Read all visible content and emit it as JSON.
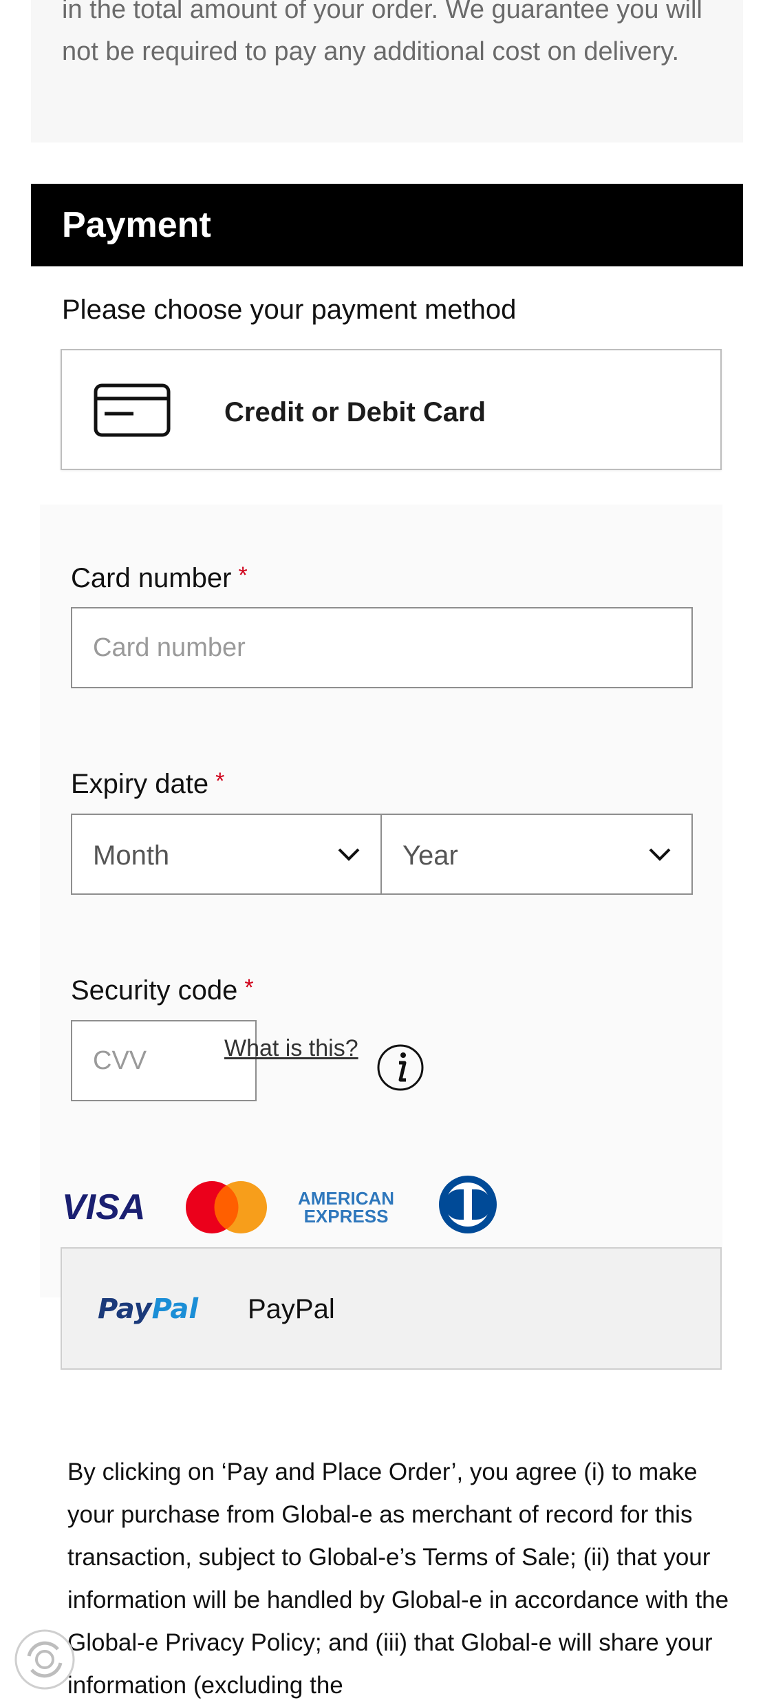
{
  "intro": {
    "text": "in the total amount of your order. We guarantee you will not be required to pay any additional cost on delivery."
  },
  "payment": {
    "title": "Payment",
    "choose_label": "Please choose your payment method",
    "card_option": {
      "label": "Credit or Debit Card",
      "icon": "credit-card-icon"
    },
    "form": {
      "card_number": {
        "label": "Card number",
        "required_mark": "*",
        "placeholder": "Card number",
        "value": ""
      },
      "expiry": {
        "label": "Expiry date",
        "required_mark": "*",
        "month": {
          "selected": "Month"
        },
        "year": {
          "selected": "Year"
        }
      },
      "security": {
        "label": "Security code",
        "required_mark": "*",
        "placeholder": "CVV",
        "value": "",
        "help_link": "What is this?",
        "info_icon": "info-icon"
      }
    },
    "card_brands": {
      "visa": "VISA",
      "mastercard": "mastercard-logo",
      "amex_line1": "AMERICAN",
      "amex_line2": "EXPRESS",
      "diners": "diners-club-logo"
    },
    "paypal_option": {
      "logo_part1": "Pay",
      "logo_part2": "Pal",
      "label": "PayPal"
    }
  },
  "terms": {
    "text": "By clicking on ‘Pay and Place Order’, you agree (i) to make your purchase from Global-e as merchant of record for this transaction, subject to Global-e’s Terms of Sale; (ii) that your information will be handled by Global-e in accordance with the Global-e Privacy Policy; and (iii) that Global-e will share your information (excluding the"
  },
  "colors": {
    "header_bg": "#000000",
    "required": "#d0021b",
    "visa_blue": "#1a1f71",
    "mc_red": "#eb001b",
    "mc_orange": "#f79e1b",
    "amex_blue": "#2e77bc",
    "diners_blue": "#004a97",
    "paypal_dark": "#1b3a7a",
    "paypal_light": "#1b8ed6"
  }
}
